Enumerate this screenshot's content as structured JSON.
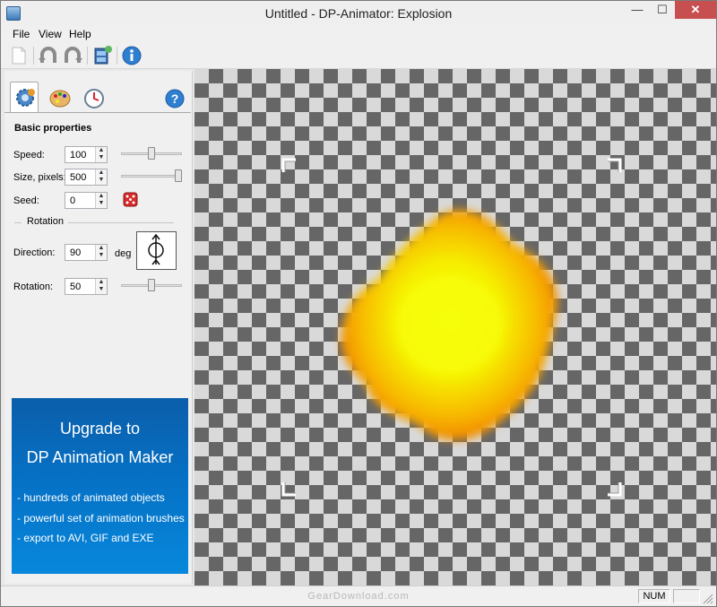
{
  "window": {
    "title": "Untitled - DP-Animator: Explosion"
  },
  "window_controls": {
    "minimize": "—",
    "maximize": "☐",
    "close": "✕"
  },
  "menu": [
    {
      "label": "File"
    },
    {
      "label": "View"
    },
    {
      "label": "Help"
    }
  ],
  "toolbar": {
    "icons": [
      "new-document-icon",
      "undo-icon",
      "redo-icon",
      "export-film-icon",
      "info-icon"
    ]
  },
  "tabs": {
    "icons": [
      "gear-settings-icon",
      "palette-icon",
      "clock-icon"
    ],
    "help_icon": "help-icon"
  },
  "basic": {
    "title": "Basic properties",
    "speed_label": "Speed:",
    "speed_value": "100",
    "speed_level": 0.5,
    "size_label": "Size, pixels:",
    "size_value": "500",
    "size_level": 1.0,
    "seed_label": "Seed:",
    "seed_value": "0",
    "rotation_group": "Rotation",
    "direction_label": "Direction:",
    "direction_value": "90",
    "direction_unit": "deg",
    "rotation_label": "Rotation:",
    "rotation_value": "50",
    "rotation_level": 0.5
  },
  "upgrade": {
    "title_line1": "Upgrade to",
    "title_line2": "DP Animation Maker",
    "items": [
      "- hundreds of animated objects",
      "- powerful set of animation brushes",
      "- export to AVI, GIF and EXE"
    ]
  },
  "status": {
    "num": "NUM",
    "watermark": "GearDownload.com"
  },
  "colors": {
    "upgrade_blue": "#0670c4",
    "explosion_core": "#f4ff00",
    "explosion_edge": "#f08a00"
  }
}
